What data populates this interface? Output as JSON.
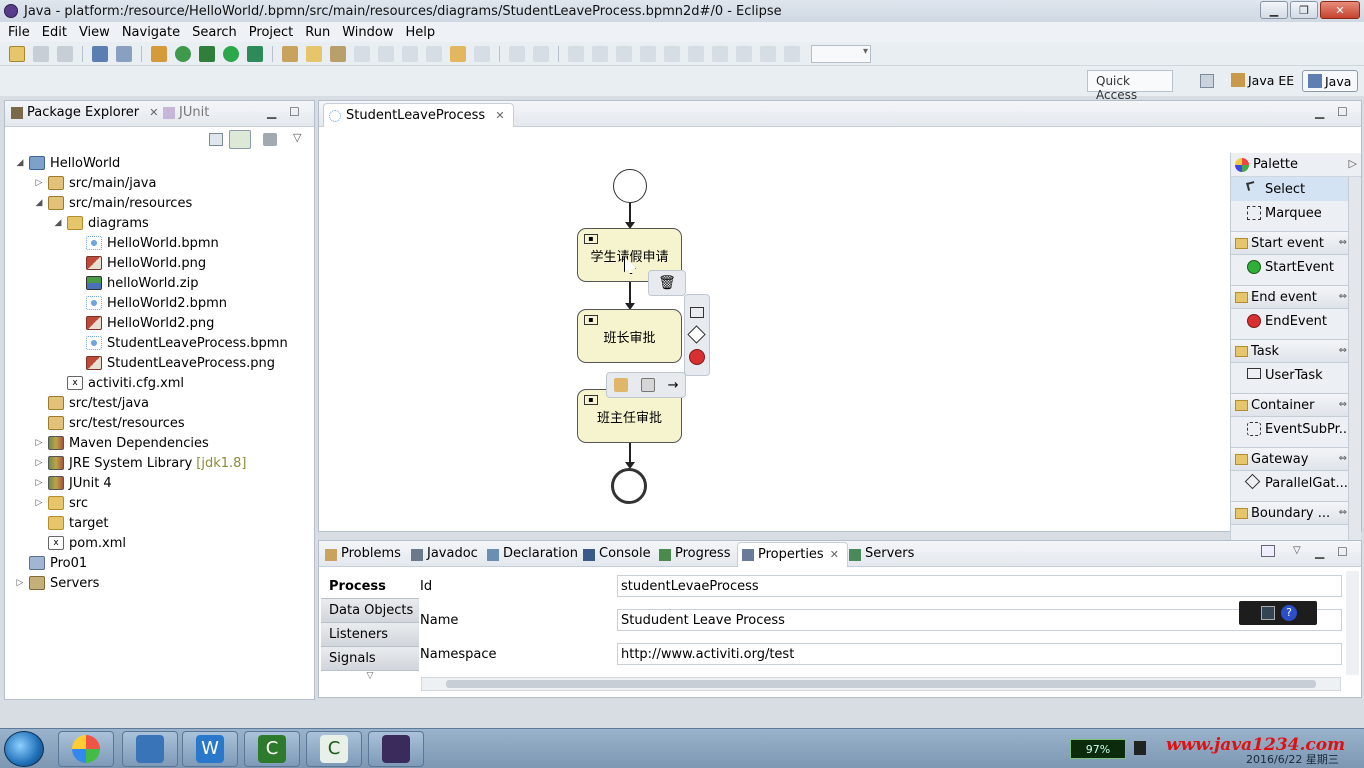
{
  "window": {
    "title": "Java - platform:/resource/HelloWorld/.bpmn/src/main/resources/diagrams/StudentLeaveProcess.bpmn2d#/0 - Eclipse",
    "minimize": "▁",
    "maximize": "❐",
    "close": "✕"
  },
  "menu": [
    "File",
    "Edit",
    "View",
    "Navigate",
    "Search",
    "Project",
    "Run",
    "Window",
    "Help"
  ],
  "perspectives": {
    "quick_access": "Quick Access",
    "java_ee": "Java EE",
    "java": "Java"
  },
  "package_explorer": {
    "tab_label": "Package Explorer",
    "junit_tab": "JUnit",
    "tree": [
      {
        "label": "HelloWorld",
        "icon": "project",
        "twisty": "◢",
        "indent": 0
      },
      {
        "label": "src/main/java",
        "icon": "srcfolder",
        "twisty": "▷",
        "indent": 1
      },
      {
        "label": "src/main/resources",
        "icon": "srcfolder",
        "twisty": "◢",
        "indent": 1
      },
      {
        "label": "diagrams",
        "icon": "folder",
        "twisty": "◢",
        "indent": 2
      },
      {
        "label": "HelloWorld.bpmn",
        "icon": "bpmn",
        "twisty": "",
        "indent": 3
      },
      {
        "label": "HelloWorld.png",
        "icon": "png",
        "twisty": "",
        "indent": 3
      },
      {
        "label": "helloWorld.zip",
        "icon": "zip",
        "twisty": "",
        "indent": 3
      },
      {
        "label": "HelloWorld2.bpmn",
        "icon": "bpmn",
        "twisty": "",
        "indent": 3
      },
      {
        "label": "HelloWorld2.png",
        "icon": "png",
        "twisty": "",
        "indent": 3
      },
      {
        "label": "StudentLeaveProcess.bpmn",
        "icon": "bpmn",
        "twisty": "",
        "indent": 3
      },
      {
        "label": "StudentLeaveProcess.png",
        "icon": "png",
        "twisty": "",
        "indent": 3
      },
      {
        "label": "activiti.cfg.xml",
        "icon": "xml",
        "twisty": "",
        "indent": 2
      },
      {
        "label": "src/test/java",
        "icon": "srcfolder",
        "twisty": "",
        "indent": 1
      },
      {
        "label": "src/test/resources",
        "icon": "srcfolder",
        "twisty": "",
        "indent": 1
      },
      {
        "label": "Maven Dependencies",
        "icon": "lib",
        "twisty": "▷",
        "indent": 1
      },
      {
        "label": "JRE System Library",
        "icon": "lib",
        "twisty": "▷",
        "indent": 1,
        "suffix": "[jdk1.8]"
      },
      {
        "label": "JUnit 4",
        "icon": "lib",
        "twisty": "▷",
        "indent": 1
      },
      {
        "label": "src",
        "icon": "folder",
        "twisty": "▷",
        "indent": 1
      },
      {
        "label": "target",
        "icon": "folder",
        "twisty": "",
        "indent": 1
      },
      {
        "label": "pom.xml",
        "icon": "xml",
        "twisty": "",
        "indent": 1
      },
      {
        "label": "Pro01",
        "icon": "closed",
        "twisty": "",
        "indent": 0
      },
      {
        "label": "Servers",
        "icon": "server",
        "twisty": "▷",
        "indent": 0
      }
    ]
  },
  "editor": {
    "tab_label": "StudentLeaveProcess",
    "tasks": [
      "学生请假申请",
      "班长审批",
      "班主任审批"
    ],
    "context_pad": {
      "delete": "🗑",
      "connect": "→"
    }
  },
  "palette": {
    "title": "Palette",
    "entries": [
      {
        "kind": "tool",
        "label": "Select",
        "icon": "select-arrow-icon",
        "selected": true
      },
      {
        "kind": "tool",
        "label": "Marquee",
        "icon": "marquee-icon",
        "selected": false
      },
      {
        "kind": "drawer",
        "label": "Start event"
      },
      {
        "kind": "item",
        "label": "StartEvent",
        "icon": "start-event-icon"
      },
      {
        "kind": "drawer",
        "label": "End event"
      },
      {
        "kind": "item",
        "label": "EndEvent",
        "icon": "end-event-icon"
      },
      {
        "kind": "drawer",
        "label": "Task"
      },
      {
        "kind": "item",
        "label": "UserTask",
        "icon": "user-task-icon"
      },
      {
        "kind": "drawer",
        "label": "Container"
      },
      {
        "kind": "item",
        "label": "EventSubPr...",
        "icon": "event-subprocess-icon"
      },
      {
        "kind": "drawer",
        "label": "Gateway"
      },
      {
        "kind": "item",
        "label": "ParallelGat...",
        "icon": "parallel-gateway-icon"
      },
      {
        "kind": "drawer",
        "label": "Boundary ..."
      }
    ]
  },
  "bottom_panel": {
    "tabs": [
      {
        "label": "Problems",
        "icon": "problems-icon"
      },
      {
        "label": "Javadoc",
        "icon": "javadoc-icon"
      },
      {
        "label": "Declaration",
        "icon": "declaration-icon"
      },
      {
        "label": "Console",
        "icon": "console-icon"
      },
      {
        "label": "Progress",
        "icon": "progress-icon"
      },
      {
        "label": "Properties",
        "icon": "properties-icon",
        "active": true
      },
      {
        "label": "Servers",
        "icon": "servers-icon"
      }
    ],
    "categories": [
      "Process",
      "Data Objects",
      "Listeners",
      "Signals"
    ],
    "properties": [
      {
        "label": "Id",
        "value": "studentLevaeProcess"
      },
      {
        "label": "Name",
        "value": "Stududent Leave Process"
      },
      {
        "label": "Namespace",
        "value": "http://www.activiti.org/test"
      }
    ]
  },
  "taskbar": {
    "battery": "97%",
    "watermark": "www.java1234.com",
    "date": "2016/6/22 星期三"
  }
}
